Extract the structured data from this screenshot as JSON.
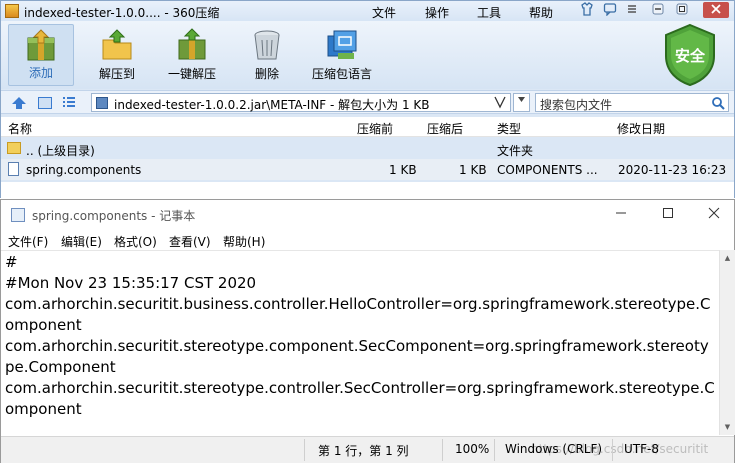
{
  "zip": {
    "title": "indexed-tester-1.0.0.... - 360压缩",
    "menu": [
      "文件",
      "操作",
      "工具",
      "帮助"
    ],
    "toolbar": [
      {
        "label": "添加",
        "icon": "add-archive-icon"
      },
      {
        "label": "解压到",
        "icon": "extract-to-icon"
      },
      {
        "label": "一键解压",
        "icon": "one-click-extract-icon"
      },
      {
        "label": "删除",
        "icon": "delete-trash-icon"
      },
      {
        "label": "压缩包语言",
        "icon": "archive-language-icon"
      }
    ],
    "security_label": "安全",
    "path": "indexed-tester-1.0.0.2.jar\\META-INF - 解包大小为 1 KB",
    "search_placeholder": "搜索包内文件",
    "columns": {
      "name": "名称",
      "packed": "压缩前",
      "size": "压缩后",
      "type": "类型",
      "modified": "修改日期"
    },
    "rows": [
      {
        "name": ".. (上级目录)",
        "packed": "",
        "size": "",
        "type": "文件夹",
        "modified": ""
      },
      {
        "name": "spring.components",
        "packed": "1 KB",
        "size": "1 KB",
        "type": "COMPONENTS ...",
        "modified": "2020-11-23 16:23"
      }
    ]
  },
  "notepad": {
    "title": "spring.components - 记事本",
    "menu": [
      "文件(F)",
      "编辑(E)",
      "格式(O)",
      "查看(V)",
      "帮助(H)"
    ],
    "content": "#\n#Mon Nov 23 15:35:17 CST 2020\ncom.arhorchin.securitit.business.controller.HelloController=org.springframework.stereotype.Component\ncom.arhorchin.securitit.stereotype.component.SecComponent=org.springframework.stereotype.Component\ncom.arhorchin.securitit.stereotype.controller.SecController=org.springframework.stereotype.Component",
    "status": {
      "position": "第 1 行，第 1 列",
      "zoom": "100%",
      "eol": "Windows (CRLF)",
      "encoding": "UTF-8"
    },
    "watermark": "https://blog.csdn.net/securitit"
  },
  "colors": {
    "zip_bg": "#dbe7f5",
    "accent": "#2e6db8",
    "shield": "#4fa23a"
  }
}
